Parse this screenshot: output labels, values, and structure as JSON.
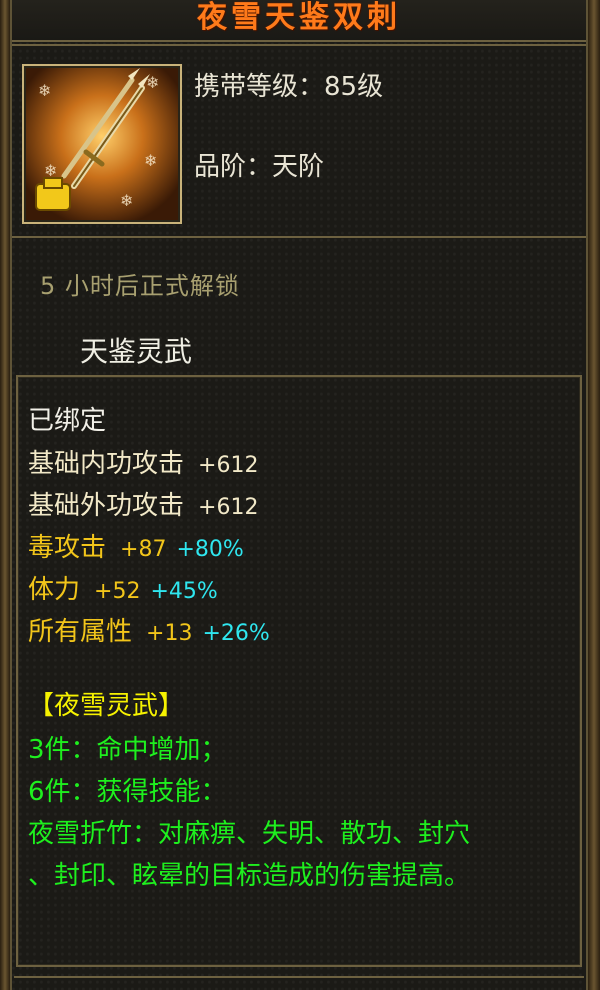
{
  "item": {
    "name": "夜雪天鉴双刺",
    "level_label": "携带等级：",
    "level_value": "85级",
    "grade_label": "品阶：",
    "grade_value": "天阶",
    "unlock_text": "5 小时后正式解锁",
    "weapon_type": "天鉴灵武"
  },
  "stats": {
    "bound": "已绑定",
    "base": [
      {
        "label": "基础内功攻击",
        "value": "+612"
      },
      {
        "label": "基础外功攻击",
        "value": "+612"
      }
    ],
    "extra": [
      {
        "label": "毒攻击",
        "value": "+87",
        "pct": "+80%"
      },
      {
        "label": "体力",
        "value": "+52",
        "pct": "+45%"
      },
      {
        "label": "所有属性",
        "value": "+13",
        "pct": "+26%"
      }
    ]
  },
  "set": {
    "title": "【夜雪灵武】",
    "lines": [
      "3件：命中增加；",
      "6件：获得技能：",
      "夜雪折竹：对麻痹、失明、散功、封穴",
      "、封印、眩晕的目标造成的伤害提高。"
    ]
  },
  "colors": {
    "title": "#ff7a1a",
    "attr_gold": "#f2c51a",
    "attr_pct": "#2fe6ef",
    "set_title": "#f6f200",
    "set_text": "#1ef01e"
  }
}
